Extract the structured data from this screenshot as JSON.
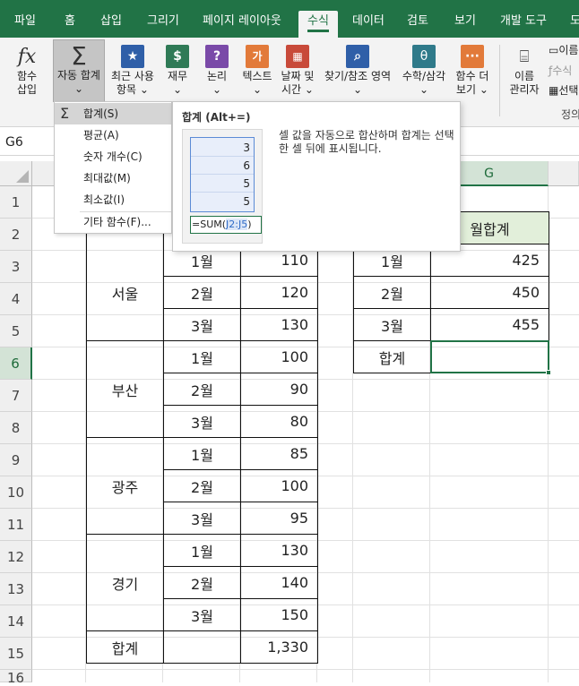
{
  "tabs": [
    "파일",
    "홈",
    "삽입",
    "그리기",
    "페이지 레이아웃",
    "수식",
    "데이터",
    "검토",
    "보기",
    "개발 도구",
    "도"
  ],
  "active_tab": "수식",
  "ribbon": {
    "insert_function": [
      "함수",
      "삽입"
    ],
    "autosum": [
      "자동 합계",
      "⌄"
    ],
    "recent": [
      "최근 사용",
      "항목 ⌄"
    ],
    "financial": [
      "재무",
      "⌄"
    ],
    "logical": [
      "논리",
      "⌄"
    ],
    "text": [
      "텍스트",
      "⌄"
    ],
    "datetime": [
      "날짜 및",
      "시간 ⌄"
    ],
    "lookup": [
      "찾기/참조 영역",
      "⌄"
    ],
    "math": [
      "수학/삼각",
      "⌄"
    ],
    "more": [
      "함수 더",
      "보기 ⌄"
    ],
    "name_manager": [
      "이름",
      "관리자"
    ],
    "side_items": [
      "이름",
      "수식",
      "선택"
    ],
    "group_label": "정의"
  },
  "namebox": "G6",
  "columns": [
    "G"
  ],
  "rows": [
    "1",
    "2",
    "3",
    "4",
    "5",
    "6",
    "7",
    "8",
    "9",
    "10",
    "11",
    "12",
    "13",
    "14",
    "15",
    "16"
  ],
  "table": {
    "regions": [
      "서울",
      "부산",
      "광주",
      "경기"
    ],
    "months": [
      "1월",
      "2월",
      "3월",
      "1월",
      "2월",
      "3월",
      "1월",
      "2월",
      "3월",
      "1월",
      "2월",
      "3월"
    ],
    "values": [
      "110",
      "120",
      "130",
      "100",
      "90",
      "80",
      "85",
      "100",
      "95",
      "130",
      "140",
      "150"
    ],
    "total_label": "합계",
    "total_value": "1,330"
  },
  "summary": {
    "header": "월합계",
    "months": [
      "1월",
      "2월",
      "3월"
    ],
    "values": [
      "425",
      "450",
      "455"
    ],
    "total_label": "합계"
  },
  "menu": {
    "sigma": "Σ",
    "items": [
      "합계(S)",
      "평균(A)",
      "숫자 개수(C)",
      "최대값(M)",
      "최소값(I)",
      "기타 함수(F)..."
    ]
  },
  "tooltip": {
    "title": "합계 (Alt+=)",
    "description": "셀 값을 자동으로 합산하며 합계는 선택한 셀 뒤에 표시됩니다.",
    "nums": [
      "3",
      "6",
      "5",
      "5"
    ],
    "formula_prefix": "=SUM(",
    "formula_ref": "J2:J5",
    "formula_suffix": ")"
  }
}
